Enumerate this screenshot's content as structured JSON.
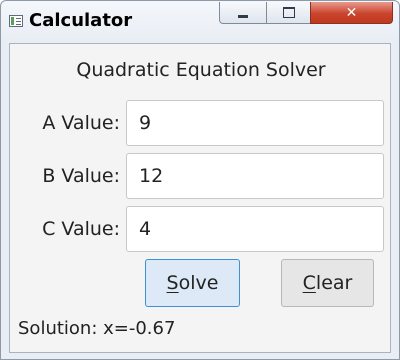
{
  "window": {
    "title": "Calculator",
    "icons": {
      "app": "window-icon",
      "minimize": "minimize-icon",
      "maximize": "maximize-icon",
      "close": "close-icon"
    },
    "close_glyph": "✕",
    "close_color": "#c9442e"
  },
  "form": {
    "heading": "Quadratic Equation Solver",
    "a": {
      "label": "A Value:",
      "value": "9"
    },
    "b": {
      "label": "B Value:",
      "value": "12"
    },
    "c": {
      "label": "C Value:",
      "value": "4"
    }
  },
  "buttons": {
    "solve": {
      "mnemonic": "S",
      "rest": "olve"
    },
    "clear": {
      "mnemonic": "C",
      "rest": "lear"
    }
  },
  "solution": "Solution: x=-0.67",
  "colors": {
    "focus_border": "#3c91d6",
    "focus_background": "#dde9f6"
  }
}
